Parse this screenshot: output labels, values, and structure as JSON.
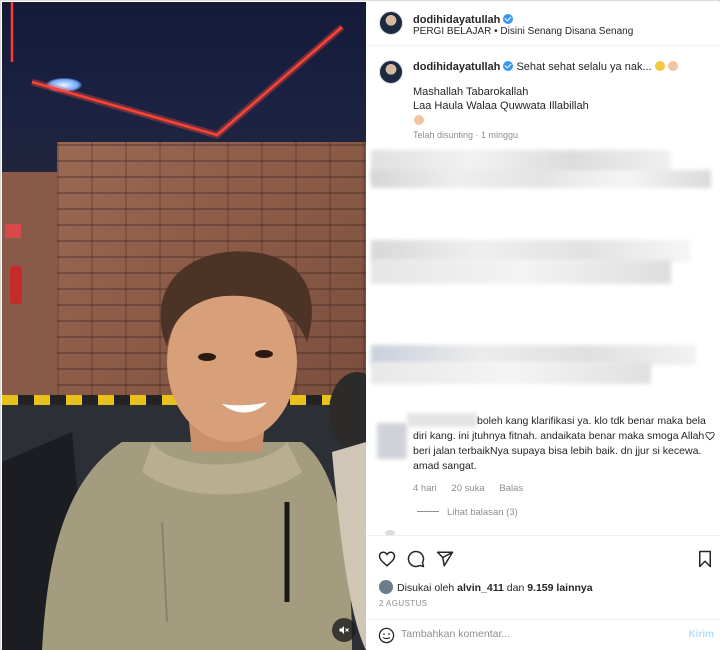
{
  "post": {
    "username": "dodihidayatullah",
    "location": "PERGI BELAJAR • Disini Senang Disana Senang"
  },
  "caption": {
    "username": "dodihidayatullah",
    "text_line1": "Sehat sehat selalu ya nak...",
    "text_line2": "Mashallah Tabarokallah",
    "text_line3": "Laa Haula Walaa Quwwata Illabillah",
    "edited": "Telah disunting · 1 minggu"
  },
  "comment": {
    "text_line1": "boleh kang klarifikasi ya. klo tdk benar maka bela",
    "text_line2": "diri kang. ini jtuhnya fitnah. andaikata benar maka smoga Allah",
    "text_line3": "beri jalan terbaikNya supaya bisa lebih baik. dn jjur si kecewa.",
    "text_line4": "amad sangat.",
    "time": "4 hari",
    "likes": "20 suka",
    "reply": "Balas",
    "view_replies": "Lihat balasan (3)"
  },
  "likes": {
    "prefix": "Disukai oleh ",
    "user": "alvin_411",
    "mid": " dan ",
    "count": "9.159 lainnya"
  },
  "date": "2 AGUSTUS",
  "add_comment": {
    "placeholder": "Tambahkan komentar...",
    "post_label": "Kirim"
  },
  "icons": {
    "like": "heart-icon",
    "comment": "comment-icon",
    "share": "share-icon",
    "save": "bookmark-icon",
    "emoji": "smiley-icon",
    "mute": "mute-icon",
    "verified": "verified-badge-icon"
  },
  "colors": {
    "verified": "#3897f0",
    "neon": "#ff3b2f",
    "muted_text": "#8e8e8e",
    "post_button": "#b2dffc"
  }
}
